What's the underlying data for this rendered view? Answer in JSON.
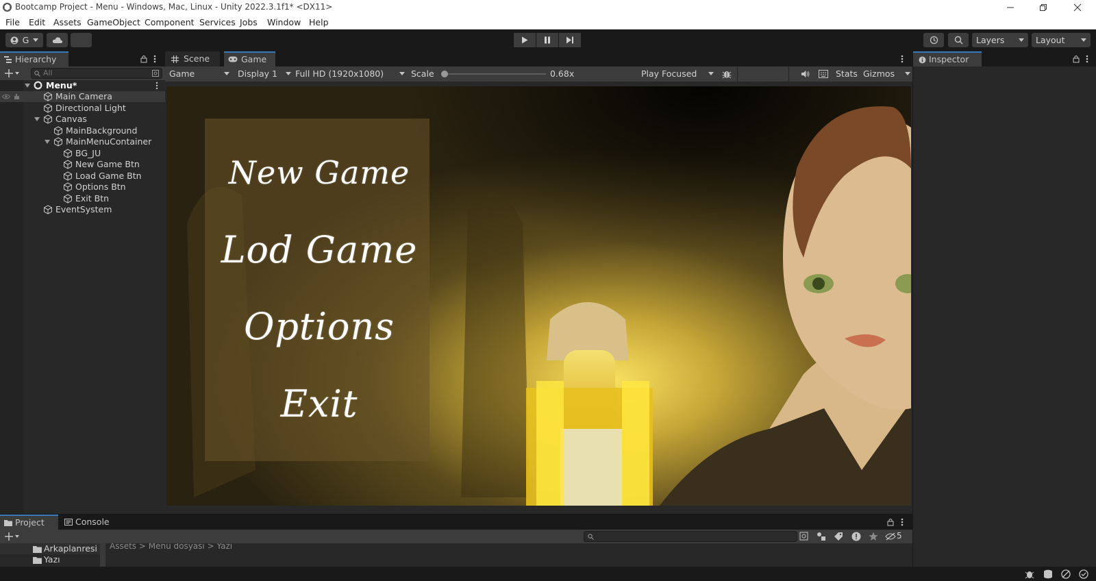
{
  "window": {
    "title": "Bootcamp Project - Menu - Windows, Mac, Linux - Unity 2022.3.1f1* <DX11>"
  },
  "menubar": [
    "File",
    "Edit",
    "Assets",
    "GameObject",
    "Component",
    "Services",
    "Jobs",
    "Window",
    "Help"
  ],
  "toolbar": {
    "account_label": "G",
    "layers_label": "Layers",
    "layout_label": "Layout"
  },
  "hierarchy": {
    "tab": "Hierarchy",
    "search_placeholder": "All",
    "scene": "Menu*",
    "items": [
      {
        "label": "Main Camera"
      },
      {
        "label": "Directional Light"
      },
      {
        "label": "Canvas"
      },
      {
        "label": "MainBackground"
      },
      {
        "label": "MainMenuContainer"
      },
      {
        "label": "BG_JU"
      },
      {
        "label": "New Game Btn"
      },
      {
        "label": "Load Game Btn"
      },
      {
        "label": "Options Btn"
      },
      {
        "label": "Exit Btn"
      },
      {
        "label": "EventSystem"
      }
    ]
  },
  "center": {
    "tabs": [
      "Scene",
      "Game"
    ],
    "active_tab": "Game",
    "game_mode": "Game",
    "display": "Display 1",
    "resolution": "Full HD (1920x1080)",
    "scale_label": "Scale",
    "scale_value": "0.68x",
    "scale_fraction": 0.0,
    "play_mode": "Play Focused",
    "stats": "Stats",
    "gizmos": "Gizmos"
  },
  "game_menu": {
    "new_game": "New Game",
    "load_game": "Lod Game",
    "options": "Options",
    "exit": "Exit"
  },
  "inspector": {
    "tab": "Inspector"
  },
  "project": {
    "tabs": [
      "Project",
      "Console"
    ],
    "folders": [
      "Arkaplanresi",
      "Yazı"
    ],
    "breadcrumb": "Assets > Menu dosyası > Yazı",
    "hidden_count": "5"
  },
  "colors": {
    "accent": "#3a79bb",
    "panel": "#282828",
    "toolbar": "#3c3c3c",
    "menu_box": "#5a4a20"
  }
}
